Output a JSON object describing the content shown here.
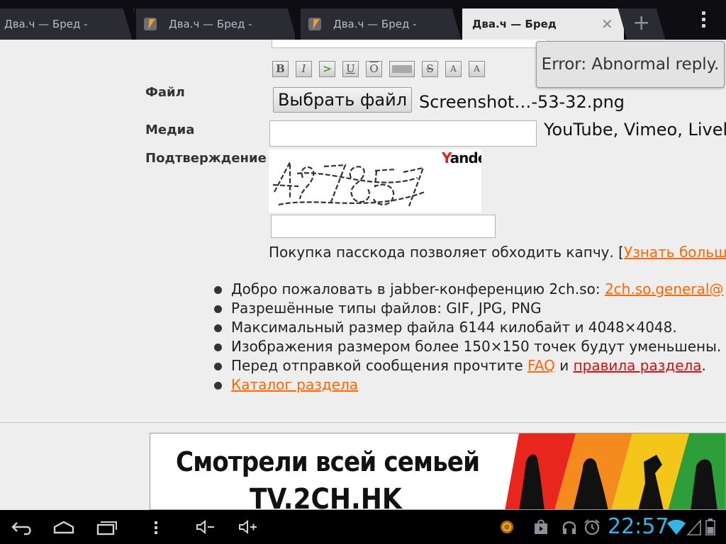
{
  "browser": {
    "tabs": [
      {
        "title": "Два.ч — Бред -",
        "active": false
      },
      {
        "title": "Два.ч — Бред -",
        "active": false
      },
      {
        "title": "Два.ч — Бред -",
        "active": false
      },
      {
        "title": "Два.ч — Бред",
        "active": true
      }
    ],
    "new_tab_symbol": "+",
    "close_symbol": "✕"
  },
  "form": {
    "format_buttons": [
      "B",
      "I",
      ">",
      "U",
      "O",
      "▬",
      "S",
      "A",
      "A"
    ],
    "file_label": "Файл",
    "file_button": "Выбрать файл",
    "file_name": "Screenshot…-53-32.png",
    "media_label": "Медиа",
    "media_value": "",
    "media_hint": "YouTube, Vimeo, Livele",
    "confirm_label": "Подтверждение",
    "captcha_text": "49738571",
    "captcha_brand_first": "Y",
    "captcha_brand_rest": "andex",
    "captcha_value": "",
    "passcode_text": "Покупка пасскода позволяет обходить капчу. [",
    "passcode_link": "Узнать больш"
  },
  "rules": [
    {
      "text": "Добро пожаловать в jabber-конференцию 2ch.so: ",
      "link": "2ch.so.general@"
    },
    {
      "text": "Разрешённые типы файлов: GIF, JPG, PNG"
    },
    {
      "text": "Максимальный размер файла 6144 килобайт и 4048×4048."
    },
    {
      "text": "Изображения размером более 150×150 точек будут уменьшены."
    },
    {
      "text": "Перед отправкой сообщения прочтите ",
      "link": "FAQ",
      "middle": " и ",
      "link2": "правила раздела",
      "tail": "."
    },
    {
      "link": "Каталог раздела"
    }
  ],
  "banner": {
    "line1": "Смотрели всей семьей",
    "line2": "TV.2CH.HK",
    "stripe_colors": [
      "#e8261e",
      "#f58a1f",
      "#f5c61a",
      "#2e9e3a"
    ]
  },
  "toast": {
    "message": "Error: Abnormal reply."
  },
  "system_bar": {
    "clock": "22:57",
    "accent": "#33b5e5",
    "icons": [
      "back-icon",
      "home-icon",
      "recent-apps-icon",
      "menu-icon",
      "volume-down-icon",
      "volume-up-icon",
      "notification-icon",
      "shop-icon",
      "headphones-icon",
      "alarm-icon",
      "wifi-icon",
      "signal-icon",
      "battery-icon"
    ]
  }
}
